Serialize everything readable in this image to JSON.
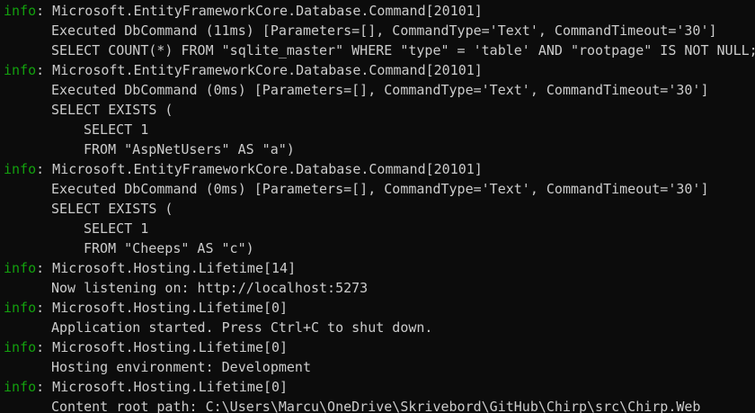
{
  "terminal": {
    "info_color": "#13a10e",
    "text_color": "#cccccc",
    "background": "#0c0c0c",
    "lines": [
      {
        "tag": "info",
        "text": ": Microsoft.EntityFrameworkCore.Database.Command[20101]"
      },
      {
        "indent": 1,
        "text": "Executed DbCommand (11ms) [Parameters=[], CommandType='Text', CommandTimeout='30']"
      },
      {
        "indent": 1,
        "text": "SELECT COUNT(*) FROM \"sqlite_master\" WHERE \"type\" = 'table' AND \"rootpage\" IS NOT NULL;"
      },
      {
        "tag": "info",
        "text": ": Microsoft.EntityFrameworkCore.Database.Command[20101]"
      },
      {
        "indent": 1,
        "text": "Executed DbCommand (0ms) [Parameters=[], CommandType='Text', CommandTimeout='30']"
      },
      {
        "indent": 1,
        "text": "SELECT EXISTS ("
      },
      {
        "indent": 2,
        "text": "SELECT 1"
      },
      {
        "indent": 2,
        "text": "FROM \"AspNetUsers\" AS \"a\")"
      },
      {
        "tag": "info",
        "text": ": Microsoft.EntityFrameworkCore.Database.Command[20101]"
      },
      {
        "indent": 1,
        "text": "Executed DbCommand (0ms) [Parameters=[], CommandType='Text', CommandTimeout='30']"
      },
      {
        "indent": 1,
        "text": "SELECT EXISTS ("
      },
      {
        "indent": 2,
        "text": "SELECT 1"
      },
      {
        "indent": 2,
        "text": "FROM \"Cheeps\" AS \"c\")"
      },
      {
        "tag": "info",
        "text": ": Microsoft.Hosting.Lifetime[14]"
      },
      {
        "indent": 1,
        "text": "Now listening on: http://localhost:5273"
      },
      {
        "tag": "info",
        "text": ": Microsoft.Hosting.Lifetime[0]"
      },
      {
        "indent": 1,
        "text": "Application started. Press Ctrl+C to shut down."
      },
      {
        "tag": "info",
        "text": ": Microsoft.Hosting.Lifetime[0]"
      },
      {
        "indent": 1,
        "text": "Hosting environment: Development"
      },
      {
        "tag": "info",
        "text": ": Microsoft.Hosting.Lifetime[0]"
      },
      {
        "indent": 1,
        "text": "Content root path: C:\\Users\\Marcu\\OneDrive\\Skrivebord\\GitHub\\Chirp\\src\\Chirp.Web"
      }
    ],
    "tag_label": "info"
  }
}
